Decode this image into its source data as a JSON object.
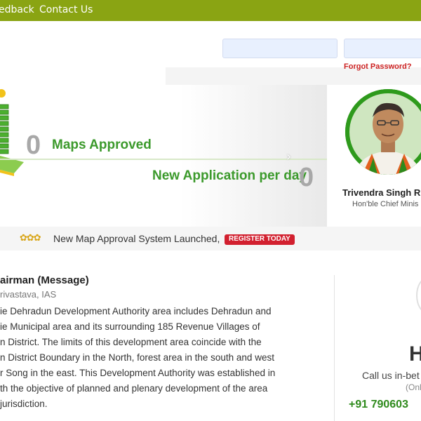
{
  "topnav": {
    "items": [
      {
        "label": "edback"
      },
      {
        "label": "Contact Us"
      }
    ]
  },
  "login": {
    "forgot_label": "Forgot Password?"
  },
  "banner": {
    "stats": [
      {
        "value": "0",
        "label": "Maps Approved"
      },
      {
        "value": "0",
        "label": "New Application per day"
      }
    ]
  },
  "cm": {
    "name": "Trivendra Singh R",
    "title": "Hon'ble Chief Minis"
  },
  "ticker": {
    "text": "New Map Approval System Launched,",
    "register_label": "REGISTER TODAY"
  },
  "message": {
    "title": "airman (Message)",
    "author": "rivastava, IAS",
    "lines": [
      "ie Dehradun Development Authority area includes Dehradun and",
      "ie Municipal area and its surrounding 185 Revenue Villages of",
      "n District. The limits of this development area coincide with the",
      "n District Boundary in the North, forest area in the south and west",
      "r Song in the east. This Development Authority was established in",
      "th the objective of planned and plenary development of the area",
      " jurisdiction."
    ]
  },
  "helpline": {
    "big": "H",
    "call": "Call us in-bet",
    "online": "(Onl",
    "phone": "+91 790603"
  },
  "colors": {
    "nav_green": "#8aa413",
    "stat_green": "#3c9a2c",
    "register_red": "#d2202f",
    "forgot_red": "#cc2222"
  }
}
